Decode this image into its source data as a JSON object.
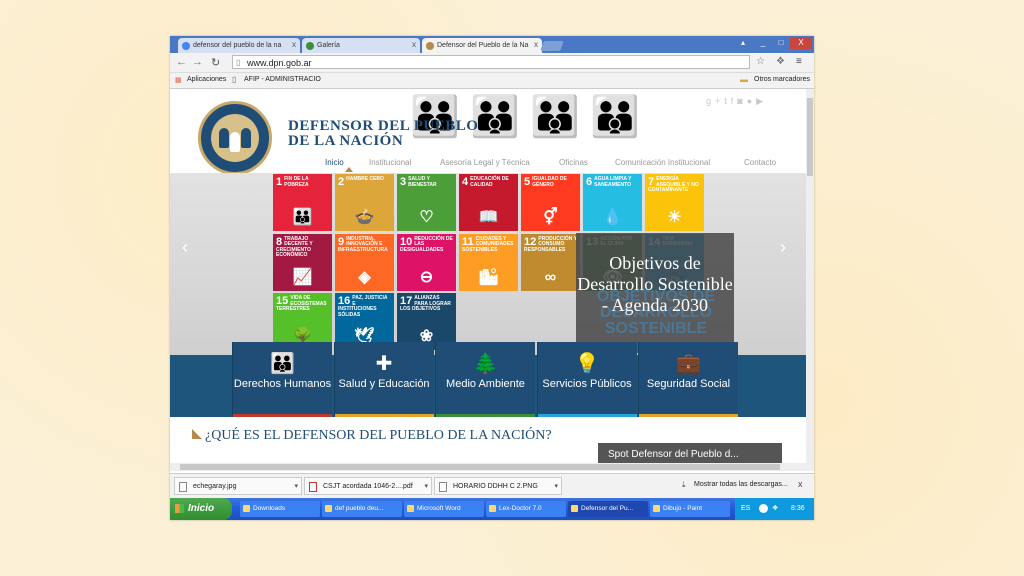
{
  "browser": {
    "tabs": [
      {
        "label": "defensor del pueblo de la na",
        "close": "x",
        "icon_color": "#4285f4"
      },
      {
        "label": "Galería",
        "close": "x",
        "icon_color": "#3a8f3a"
      },
      {
        "label": "Defensor del Pueblo de la Na",
        "close": "x",
        "icon_color": "#b58a4a"
      }
    ],
    "window_controls": [
      "_",
      "□",
      "X"
    ],
    "url": "www.dpn.gob.ar",
    "bookmarks": {
      "apps": "Aplicaciones",
      "afip": "AFIP - ADMINISTRACIO",
      "other": "Otros marcadores"
    }
  },
  "site": {
    "title_line1": "DEFENSOR DEL PUEBLO",
    "title_line2": "DE LA NACIÓN",
    "menu": [
      "Inicio",
      "Institucional",
      "Asesoría Legal y Técnica",
      "Oficinas",
      "Comunicación Institucional",
      "Contacto"
    ],
    "social_icons": [
      "google-plus-icon",
      "twitter-icon",
      "facebook-icon",
      "instagram-icon",
      "flickr-icon",
      "youtube-icon"
    ],
    "sdg_tiles": [
      {
        "num": "1",
        "text": "FIN DE LA POBREZA",
        "color": "#e5243b",
        "sym": "👪"
      },
      {
        "num": "2",
        "text": "HAMBRE CERO",
        "color": "#dda63a",
        "sym": "🍲"
      },
      {
        "num": "3",
        "text": "SALUD Y BIENESTAR",
        "color": "#4c9f38",
        "sym": "♡"
      },
      {
        "num": "4",
        "text": "EDUCACIÓN DE CALIDAD",
        "color": "#c5192d",
        "sym": "📖"
      },
      {
        "num": "5",
        "text": "IGUALDAD DE GÉNERO",
        "color": "#ff3a21",
        "sym": "⚥"
      },
      {
        "num": "6",
        "text": "AGUA LIMPIA Y SANEAMIENTO",
        "color": "#26bde2",
        "sym": "💧"
      },
      {
        "num": "7",
        "text": "ENERGÍA ASEQUIBLE Y NO CONTAMINANTE",
        "color": "#fcc30b",
        "sym": "☀"
      },
      {
        "num": "8",
        "text": "TRABAJO DECENTE Y CRECIMIENTO ECONÓMICO",
        "color": "#a21942",
        "sym": "📈"
      },
      {
        "num": "9",
        "text": "INDUSTRIA, INNOVACIÓN E INFRAESTRUCTURA",
        "color": "#fd6925",
        "sym": "◈"
      },
      {
        "num": "10",
        "text": "REDUCCIÓN DE LAS DESIGUALDADES",
        "color": "#dd1367",
        "sym": "⊖"
      },
      {
        "num": "11",
        "text": "CIUDADES Y COMUNIDADES SOSTENIBLES",
        "color": "#fd9d24",
        "sym": "🏙"
      },
      {
        "num": "12",
        "text": "PRODUCCIÓN Y CONSUMO RESPONSABLES",
        "color": "#bf8b2e",
        "sym": "∞"
      },
      {
        "num": "13",
        "text": "ACCIÓN POR EL CLIMA",
        "color": "#3f7e44",
        "sym": "👁"
      },
      {
        "num": "14",
        "text": "VIDA SUBMARINA",
        "color": "#0a97d9",
        "sym": "🐟"
      },
      {
        "num": "15",
        "text": "VIDA DE ECOSISTEMAS TERRESTRES",
        "color": "#56c02b",
        "sym": "🌳"
      },
      {
        "num": "16",
        "text": "PAZ, JUSTICIA E INSTITUCIONES SÓLIDAS",
        "color": "#00689d",
        "sym": "🕊"
      },
      {
        "num": "17",
        "text": "ALIANZAS PARA LOGRAR LOS OBJETIVOS",
        "color": "#19486a",
        "sym": "❀"
      }
    ],
    "slide_caption": "Objetivos de Desarrollo Sostenible - Agenda 2030",
    "slide_ghost": "OBJETIVOS DE DESARROLLO SOSTENIBLE",
    "categories": [
      {
        "label": "Derechos Humanos",
        "icon": "people-icon",
        "glyph": "👪",
        "bar": "#c0392b"
      },
      {
        "label": "Salud y Educación",
        "icon": "plus-icon",
        "glyph": "✚",
        "bar": "#e2a32a"
      },
      {
        "label": "Medio Ambiente",
        "icon": "tree-icon",
        "glyph": "🌲",
        "bar": "#3a8f3a"
      },
      {
        "label": "Servicios Públicos",
        "icon": "lightbulb-icon",
        "glyph": "💡",
        "bar": "#26a5d6"
      },
      {
        "label": "Seguridad Social",
        "icon": "briefcase-icon",
        "glyph": "💼",
        "bar": "#e2a32a"
      }
    ],
    "section_title": "¿QUÉ ES EL DEFENSOR DEL PUEBLO DE LA NACIÓN?",
    "spot_title": "Spot Defensor del Pueblo d..."
  },
  "downloads": {
    "items": [
      "echegaray.jpg",
      "CSJT acordada 1046-2....pdf",
      "HORARIO DDHH C 2.PNG"
    ],
    "show_all": "Mostrar todas las descargas...",
    "close": "x"
  },
  "taskbar": {
    "start": "Inicio",
    "items": [
      "Downloads",
      "def pueblo deu...",
      "Microsoft Word",
      "Lex-Doctor 7.0",
      "Defensor del Pu...",
      "Dibujo - Paint"
    ],
    "lang": "ES",
    "time": "8:36"
  }
}
